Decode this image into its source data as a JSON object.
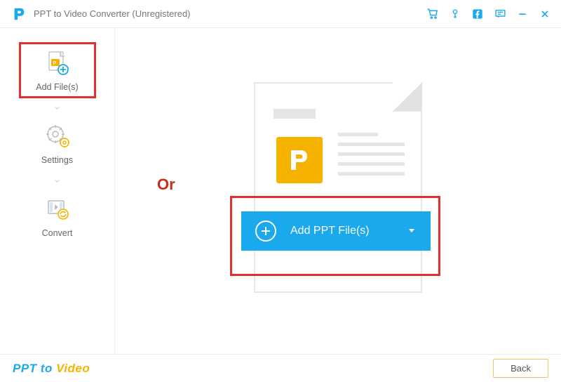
{
  "titlebar": {
    "title": "PPT to Video Converter (Unregistered)"
  },
  "sidebar": {
    "items": [
      {
        "label": "Add File(s)"
      },
      {
        "label": "Settings"
      },
      {
        "label": "Convert"
      }
    ]
  },
  "main": {
    "or_label": "Or",
    "add_button_label": "Add PPT File(s)"
  },
  "footer": {
    "brand_part1": "PPT to ",
    "brand_part2": "Video",
    "back_label": "Back"
  }
}
